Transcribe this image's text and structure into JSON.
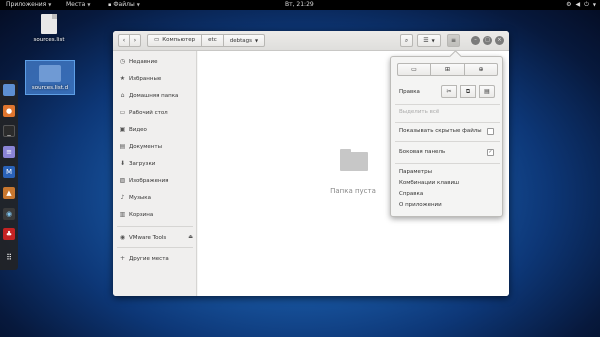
{
  "topbar": {
    "apps": "Приложения",
    "places": "Места",
    "files": "Файлы",
    "clock": "Вт, 21:29"
  },
  "desktop": {
    "icons": [
      {
        "label": "sources.list"
      },
      {
        "label": "sources.list.d"
      }
    ]
  },
  "window": {
    "path": [
      "Компьютер",
      "etc",
      "debtags"
    ],
    "sidebar": [
      {
        "label": "Недавние",
        "icon": "clock-icon"
      },
      {
        "label": "Избранные",
        "icon": "star-icon"
      },
      {
        "label": "Домашняя папка",
        "icon": "home-icon"
      },
      {
        "label": "Рабочий стол",
        "icon": "desktop-icon"
      },
      {
        "label": "Видео",
        "icon": "video-icon"
      },
      {
        "label": "Документы",
        "icon": "document-icon"
      },
      {
        "label": "Загрузки",
        "icon": "download-icon"
      },
      {
        "label": "Изображения",
        "icon": "image-icon"
      },
      {
        "label": "Музыка",
        "icon": "music-icon"
      },
      {
        "label": "Корзина",
        "icon": "trash-icon"
      },
      {
        "label": "VMware Tools",
        "icon": "drive-icon"
      },
      {
        "label": "Другие места",
        "icon": "plus-icon"
      }
    ],
    "empty_text": "Папка пуста"
  },
  "menu": {
    "edit": "Правка",
    "select_all": "Выделить всё",
    "show_hidden": "Показывать скрытые файлы",
    "sidebar": "Боковая панель",
    "preferences": "Параметры",
    "shortcuts": "Комбинации клавиш",
    "help": "Справка",
    "about": "О приложении"
  }
}
